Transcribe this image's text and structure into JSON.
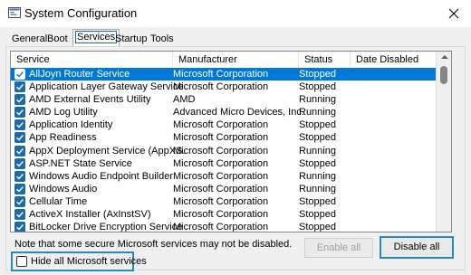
{
  "window": {
    "title": "System Configuration",
    "icon": "system-config-icon",
    "close_icon": "close-icon"
  },
  "tabs": [
    {
      "label": "General"
    },
    {
      "label": "Boot"
    },
    {
      "label": "Services",
      "active": true
    },
    {
      "label": "Startup"
    },
    {
      "label": "Tools"
    }
  ],
  "table": {
    "headers": {
      "service": "Service",
      "manufacturer": "Manufacturer",
      "status": "Status",
      "date_disabled": "Date Disabled"
    },
    "rows": [
      {
        "checked": true,
        "service": "AllJoyn Router Service",
        "manufacturer": "Microsoft Corporation",
        "status": "Stopped",
        "date_disabled": "",
        "selected": true
      },
      {
        "checked": true,
        "service": "Application Layer Gateway Service",
        "manufacturer": "Microsoft Corporation",
        "status": "Stopped",
        "date_disabled": ""
      },
      {
        "checked": true,
        "service": "AMD External Events Utility",
        "manufacturer": "AMD",
        "status": "Running",
        "date_disabled": ""
      },
      {
        "checked": true,
        "service": "AMD Log Utility",
        "manufacturer": "Advanced Micro Devices, Inc.",
        "status": "Running",
        "date_disabled": ""
      },
      {
        "checked": true,
        "service": "Application Identity",
        "manufacturer": "Microsoft Corporation",
        "status": "Stopped",
        "date_disabled": ""
      },
      {
        "checked": true,
        "service": "App Readiness",
        "manufacturer": "Microsoft Corporation",
        "status": "Stopped",
        "date_disabled": ""
      },
      {
        "checked": true,
        "service": "AppX Deployment Service (AppXS...",
        "manufacturer": "Microsoft Corporation",
        "status": "Running",
        "date_disabled": ""
      },
      {
        "checked": true,
        "service": "ASP.NET State Service",
        "manufacturer": "Microsoft Corporation",
        "status": "Stopped",
        "date_disabled": ""
      },
      {
        "checked": true,
        "service": "Windows Audio Endpoint Builder",
        "manufacturer": "Microsoft Corporation",
        "status": "Running",
        "date_disabled": ""
      },
      {
        "checked": true,
        "service": "Windows Audio",
        "manufacturer": "Microsoft Corporation",
        "status": "Running",
        "date_disabled": ""
      },
      {
        "checked": true,
        "service": "Cellular Time",
        "manufacturer": "Microsoft Corporation",
        "status": "Stopped",
        "date_disabled": ""
      },
      {
        "checked": true,
        "service": "ActiveX Installer (AxInstSV)",
        "manufacturer": "Microsoft Corporation",
        "status": "Stopped",
        "date_disabled": ""
      },
      {
        "checked": true,
        "service": "BitLocker Drive Encryption Service",
        "manufacturer": "Microsoft Corporation",
        "status": "Stopped",
        "date_disabled": ""
      }
    ]
  },
  "footer": {
    "note": "Note that some secure Microsoft services may not be disabled.",
    "enable_all_label": "Enable all",
    "disable_all_label": "Disable all",
    "hide_ms_label": "Hide all Microsoft services",
    "hide_ms_checked": false
  },
  "colors": {
    "selection": "#0078d7",
    "checkbox": "#1f6aa6",
    "focus_border": "#2a8ab4"
  }
}
